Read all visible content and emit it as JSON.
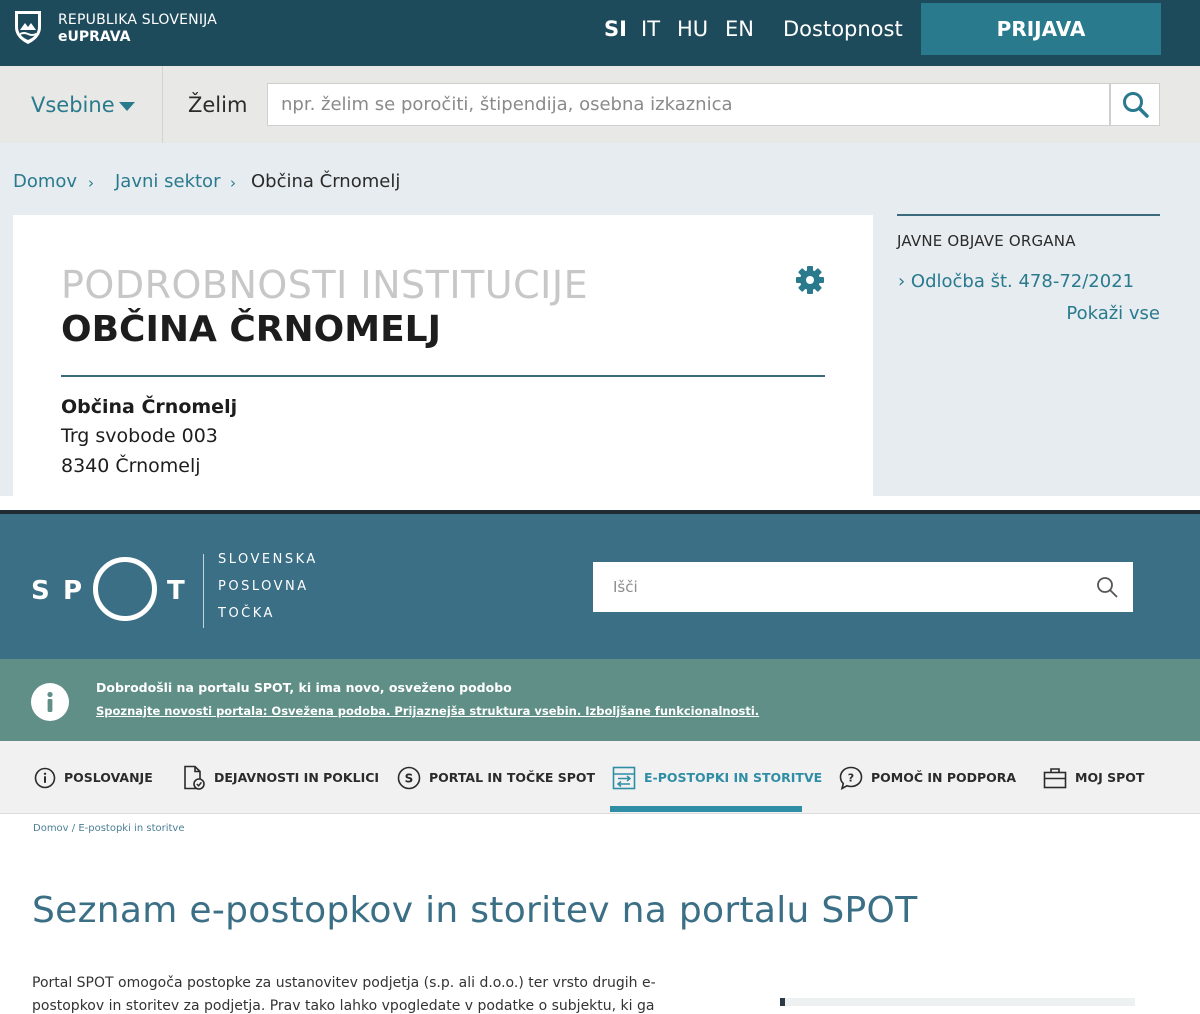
{
  "euprava": {
    "logo": {
      "line1": "REPUBLIKA SLOVENIJA",
      "line2": "eUPRAVA"
    },
    "languages": [
      "SI",
      "IT",
      "HU",
      "EN"
    ],
    "active_language": "SI",
    "accessibility_label": "Dostopnost",
    "login_label": "PRIJAVA",
    "menu_label": "Vsebine",
    "want_label": "Želim",
    "search_placeholder": "npr. želim se poročiti, štipendija, osebna izkaznica",
    "breadcrumb": [
      "Domov",
      "Javni sektor",
      "Občina Črnomelj"
    ],
    "breadcrumb_separator": "›",
    "card": {
      "heading": "PODROBNOSTI INSTITUCIJE",
      "name": "OBČINA ČRNOMELJ",
      "address": [
        "Občina Črnomelj",
        "Trg svobode 003",
        "8340 Črnomelj"
      ]
    },
    "sidebar": {
      "title": "JAVNE OBJAVE ORGANA",
      "link": "› Odločba št. 478-72/2021",
      "show_all": "Pokaži vse"
    },
    "colors": {
      "header": "#1e4b5b",
      "accent": "#2a7a8e",
      "login_button": "#2a7a8e"
    }
  },
  "spot": {
    "logo": {
      "letters": [
        "S",
        "P",
        "T"
      ],
      "tagline": [
        "SLOVENSKA",
        "POSLOVNA",
        "TOČKA"
      ]
    },
    "search_placeholder": "Išči",
    "notice": {
      "title": "Dobrodošli na portalu SPOT, ki ima novo, osveženo podobo",
      "link": "Spoznajte novosti portala: Osvežena podoba. Prijaznejša struktura vsebin. Izboljšane funkcionalnosti."
    },
    "nav": [
      {
        "label": "POSLOVANJE",
        "icon": "info-circle-icon"
      },
      {
        "label": "DEJAVNOSTI IN POKLICI",
        "icon": "document-check-icon"
      },
      {
        "label": "PORTAL IN TOČKE SPOT",
        "icon": "s-circle-icon"
      },
      {
        "label": "E-POSTOPKI IN STORITVE",
        "icon": "transfer-icon"
      },
      {
        "label": "POMOČ IN PODPORA",
        "icon": "question-bubble-icon"
      },
      {
        "label": "MOJ SPOT",
        "icon": "briefcase-icon"
      }
    ],
    "active_nav": "E-POSTOPKI IN STORITVE",
    "breadcrumb": "Domov  /  E-postopki in storitve",
    "title": "Seznam e-postopkov in storitev na portalu SPOT",
    "intro_line1": "Portal SPOT omogoča postopke za ustanovitev podjetja (s.p. ali d.o.o.) ter vrsto drugih e-",
    "intro_line2": "postopkov in storitev za podjetja. Prav tako lahko vpogledate v podatke o subjektu, ki ga",
    "colors": {
      "header": "#3b6f86",
      "notice": "#5f8f86",
      "active_nav": "#2f8ea5"
    }
  }
}
